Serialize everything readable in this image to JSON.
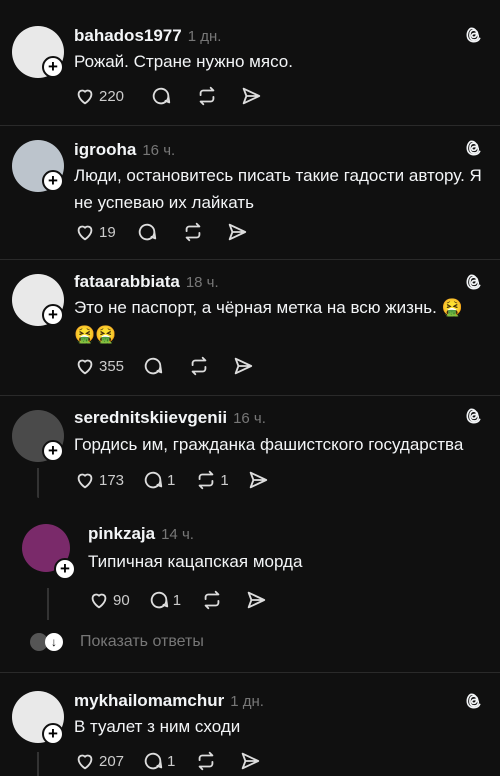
{
  "comments": [
    {
      "username": "bahados1977",
      "time": "1 дн.",
      "text": "Рожай. Стране нужно мясо.",
      "likes": "220",
      "replies": "",
      "reposts": ""
    },
    {
      "username": "igrooha",
      "time": "16 ч.",
      "text": "Люди, остановитесь писать такие гадости автору. Я не успеваю их лайкать",
      "likes": "19",
      "replies": "",
      "reposts": ""
    },
    {
      "username": "fataarabbiata",
      "time": "18 ч.",
      "text": "Это не паспорт, а чёрная метка на всю жизнь. 🤮 🤮🤮",
      "likes": "355",
      "replies": "",
      "reposts": ""
    },
    {
      "username": "serednitskiievgenii",
      "time": "16 ч.",
      "text": "Гордись им, гражданка фашистского государства",
      "likes": "173",
      "replies": "1",
      "reposts": "1"
    },
    {
      "username": "pinkzaja",
      "time": "14 ч.",
      "text": "Типичная кацапская морда",
      "likes": "90",
      "replies": "1",
      "reposts": ""
    },
    {
      "username": "mykhailomamchur",
      "time": "1 дн.",
      "text": "В туалет з ним сходи",
      "likes": "207",
      "replies": "1",
      "reposts": ""
    }
  ],
  "show_replies_label": "Показать ответы",
  "icons": [
    "threads-icon",
    "heart-icon",
    "comment-icon",
    "repost-icon",
    "share-icon",
    "plus-icon"
  ],
  "colors": {
    "background": "#101010",
    "text": "#f3f5f7",
    "muted": "#777777",
    "divider": "#2a2a2a"
  }
}
